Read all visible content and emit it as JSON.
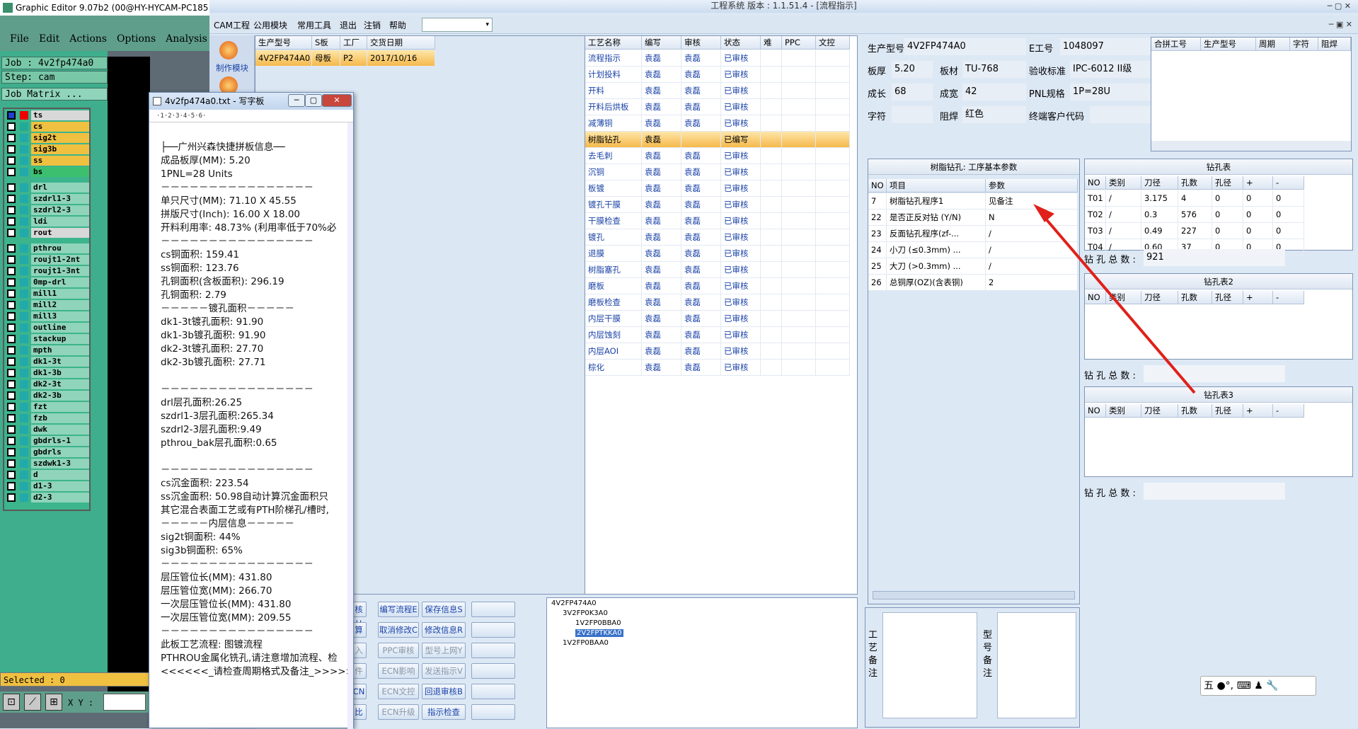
{
  "graphic_editor": {
    "title": "Graphic Editor 9.07b2 (00@HY-HYCAM-PC185",
    "menu": [
      "File",
      "Edit",
      "Actions",
      "Options",
      "Analysis"
    ],
    "job": "Job : 4v2fp474a0",
    "step": "Step: cam",
    "job_matrix": "Job Matrix ...",
    "layers": [
      "ts",
      "cs",
      "sig2t",
      "sig3b",
      "ss",
      "bs",
      "drl",
      "szdrl1-3",
      "szdrl2-3",
      "ldi",
      "rout",
      "pthrou",
      "roujt1-2nt",
      "roujt1-3nt",
      "0mp-drl",
      "mill1",
      "mill2",
      "mill3",
      "outline",
      "stackup",
      "mpth",
      "dk1-3t",
      "dk1-3b",
      "dk2-3t",
      "dk2-3b",
      "fzt",
      "fzb",
      "dwk",
      "gbdrls-1",
      "gbdrls",
      "szdwk1-3",
      "d",
      "d1-3",
      "d2-3"
    ],
    "selected": "Selected : 0",
    "xy_label": "X Y :"
  },
  "notepad": {
    "title": "4v2fp474a0.txt - 写字板",
    "ruler": "·1·2·3·4·5·6·",
    "lines": [
      "├──广州兴森快捷拼板信息──",
      "成品板厚(MM): 5.20",
      "1PNL=28 Units",
      "－－－－－－－－－－－－－－－－",
      "单只尺寸(MM): 71.10 X 45.55",
      "拼版尺寸(Inch): 16.00 X 18.00",
      "开料利用率: 48.73% (利用率低于70%必",
      "－－－－－－－－－－－－－－－－",
      "cs铜面积: 159.41",
      "ss铜面积: 123.76",
      "孔铜面积(含板面积): 296.19",
      "孔铜面积: 2.79",
      "－－－－－镀孔面积－－－－－",
      "dk1-3t镀孔面积: 91.90",
      "dk1-3b镀孔面积: 91.90",
      "dk2-3t镀孔面积: 27.70",
      "dk2-3b镀孔面积: 27.71",
      "",
      "－－－－－－－－－－－－－－－－",
      "drl层孔面积:26.25",
      "szdrl1-3层孔面积:265.34",
      "szdrl2-3层孔面积:9.49",
      "pthrou_bak层孔面积:0.65",
      "",
      "－－－－－－－－－－－－－－－－",
      "cs沉金面积: 223.54",
      "ss沉金面积: 50.98自动计算沉金面积只",
      "其它混合表面工艺或有PTH阶梯孔/槽时,",
      "－－－－－内层信息－－－－－",
      "sig2t铜面积: 44%",
      "sig3b铜面积: 65%",
      "－－－－－－－－－－－－－－－－",
      "层压管位长(MM): 431.80",
      "层压管位宽(MM): 266.70",
      "一次层压管位长(MM): 431.80",
      "一次层压管位宽(MM): 209.55",
      "－－－－－－－－－－－－－－－－",
      "此板工艺流程: 图镀流程",
      "PTHROU金属化铣孔,请注意增加流程、检",
      "<<<<<<_请检查周期格式及备注_>>>>>"
    ]
  },
  "main": {
    "title": "工程系统  版本 : 1.1.51.4 - [流程指示]",
    "menu": [
      "CAM工程",
      "公用模块",
      "常用工具",
      "退出",
      "注销",
      "帮助"
    ],
    "side_buttons": [
      "制作模块"
    ],
    "order_table": {
      "headers": [
        "生产型号",
        "S板",
        "工厂",
        "交货日期"
      ],
      "row": [
        "4V2FP474A0",
        "母板",
        "P2",
        "2017/10/16"
      ]
    },
    "process_table": {
      "headers": [
        "工艺名称",
        "编写",
        "审核",
        "状态",
        "难",
        "PPC",
        "文控"
      ],
      "rows": [
        [
          "流程指示",
          "袁磊",
          "袁磊",
          "已审核"
        ],
        [
          "计划投料",
          "袁磊",
          "袁磊",
          "已审核"
        ],
        [
          "开料",
          "袁磊",
          "袁磊",
          "已审核"
        ],
        [
          "开料后烘板",
          "袁磊",
          "袁磊",
          "已审核"
        ],
        [
          "减薄铜",
          "袁磊",
          "袁磊",
          "已审核"
        ],
        [
          "树脂钻孔",
          "袁磊",
          "",
          "已编写"
        ],
        [
          "去毛刺",
          "袁磊",
          "袁磊",
          "已审核"
        ],
        [
          "沉铜",
          "袁磊",
          "袁磊",
          "已审核"
        ],
        [
          "板镀",
          "袁磊",
          "袁磊",
          "已审核"
        ],
        [
          "镀孔干膜",
          "袁磊",
          "袁磊",
          "已审核"
        ],
        [
          "干膜检查",
          "袁磊",
          "袁磊",
          "已审核"
        ],
        [
          "镀孔",
          "袁磊",
          "袁磊",
          "已审核"
        ],
        [
          "退膜",
          "袁磊",
          "袁磊",
          "已审核"
        ],
        [
          "树脂塞孔",
          "袁磊",
          "袁磊",
          "已审核"
        ],
        [
          "磨板",
          "袁磊",
          "袁磊",
          "已审核"
        ],
        [
          "磨板检查",
          "袁磊",
          "袁磊",
          "已审核"
        ],
        [
          "内层干膜",
          "袁磊",
          "袁磊",
          "已审核"
        ],
        [
          "内层蚀刻",
          "袁磊",
          "袁磊",
          "已审核"
        ],
        [
          "内层AOI",
          "袁磊",
          "袁磊",
          "已审核"
        ],
        [
          "棕化",
          "袁磊",
          "袁磊",
          "已审核"
        ]
      ]
    },
    "info": {
      "prod_label": "生产型号",
      "prod_value": "4V2FP474A0",
      "eno_label": "E工号",
      "eno_value": "1048097",
      "thick_label": "板厚",
      "thick_value": "5.20",
      "material_label": "板材",
      "material_value": "TU-768",
      "std_label": "验收标准",
      "std_value": "IPC-6012 II级",
      "len_label": "成长",
      "len_value": "68",
      "wid_label": "成宽",
      "wid_value": "42",
      "pnl_label": "PNL规格",
      "pnl_value": "1P=28U",
      "char_label": "字符",
      "char_value": "",
      "mask_label": "阻焊",
      "mask_value": "红色",
      "cust_label": "终端客户代码",
      "cust_value": ""
    },
    "merge_table": {
      "headers": [
        "合拼工号",
        "生产型号",
        "周期",
        "字符",
        "阻焊"
      ]
    },
    "params": {
      "title": "树脂钻孔: 工序基本参数",
      "headers": [
        "NO",
        "项目",
        "参数"
      ],
      "rows": [
        [
          "7",
          "树脂钻孔程序1",
          "见备注"
        ],
        [
          "22",
          "是否正反对钻 (Y/N)",
          "N"
        ],
        [
          "23",
          "反面钻孔程序(zf-...",
          "/"
        ],
        [
          "24",
          "小刀 (≤0.3mm) ...",
          "/"
        ],
        [
          "25",
          "大刀 (>0.3mm) ...",
          "/"
        ],
        [
          "26",
          "总铜厚(OZ)(含表铜)",
          "2"
        ]
      ]
    },
    "drill1": {
      "title": "钻孔表",
      "headers": [
        "NO",
        "类别",
        "刀径",
        "孔数",
        "孔径",
        "+",
        "-"
      ],
      "rows": [
        [
          "T01",
          "/",
          "3.175",
          "4",
          "0",
          "0",
          "0"
        ],
        [
          "T02",
          "/",
          "0.3",
          "576",
          "0",
          "0",
          "0"
        ],
        [
          "T03",
          "/",
          "0.49",
          "227",
          "0",
          "0",
          "0"
        ],
        [
          "T04",
          "/",
          "0.60",
          "37",
          "0",
          "0",
          "0"
        ]
      ],
      "total_label": "钻 孔 总 数 :",
      "total_value": "921"
    },
    "drill2": {
      "title": "钻孔表2",
      "headers": [
        "NO",
        "类别",
        "刀径",
        "孔数",
        "孔径",
        "+",
        "-"
      ],
      "total_label": "钻 孔 总 数 :",
      "total_value": ""
    },
    "drill3": {
      "title": "钻孔表3",
      "headers": [
        "NO",
        "类别",
        "刀径",
        "孔数",
        "孔径",
        "+",
        "-"
      ],
      "total_label": "钻 孔 总 数 :",
      "total_value": ""
    },
    "buttons": [
      [
        "核H",
        "编写流程E",
        "保存信息S",
        ""
      ],
      [
        "算",
        "取消修改C",
        "修改信息R",
        ""
      ],
      [
        "入",
        "PPC审核",
        "型号上网Y",
        ""
      ],
      [
        "件",
        "ECN影响",
        "发送指示V",
        ""
      ],
      [
        "CN",
        "ECN文控",
        "回退审核B",
        ""
      ],
      [
        "比",
        "ECN升级",
        "指示检查",
        ""
      ]
    ],
    "tree": [
      "4V2FP474A0",
      "3V2FP0K3A0",
      "1V2FP0BBA0",
      "2V2FPTKKA0",
      "1V2FP0BAA0"
    ],
    "process_note_label": "工艺备注",
    "model_note_label": "型号备注",
    "ime": "五 ●°, ⌨ ♟ 🔧"
  },
  "colors": {
    "highlight": "#f6b94c",
    "arrow": "#e0201a",
    "accent_blue": "#1b43a8"
  }
}
